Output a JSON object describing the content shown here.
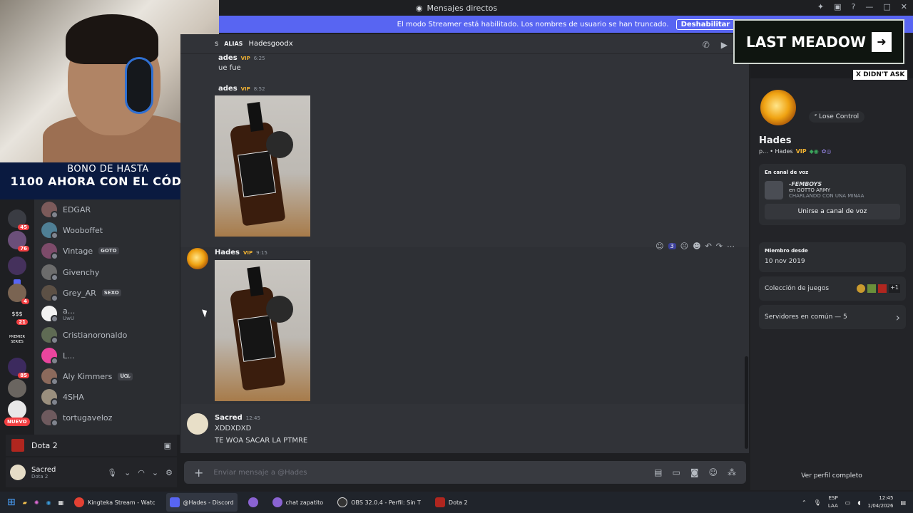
{
  "window": {
    "title": "Mensajes directos"
  },
  "streamer_banner": {
    "text": "El modo Streamer está habilitado. Los nombres de usuario se han truncado.",
    "button": "Deshabilitar"
  },
  "webcam_promo": {
    "line1": "BONO DE HASTA",
    "line2": "1100 AHORA CON EL CÓDIGO"
  },
  "overlay": {
    "title": "LAST MEADOW",
    "tag": "X DIDN'T ASK"
  },
  "guild_badges": [
    "45",
    "76",
    "4",
    "21",
    "85"
  ],
  "guild_labels": {
    "money": "$$$",
    "premier": "PREMIER SERIES",
    "new": "NUEVO"
  },
  "dm_list": [
    {
      "name": "EDGAR"
    },
    {
      "name": "Wooboffet"
    },
    {
      "name": "Vintage",
      "tag": "GOTO"
    },
    {
      "name": "Givenchy"
    },
    {
      "name": "Grey_AR",
      "tag": "SEXO"
    },
    {
      "name": "a...",
      "sub": "UwU"
    },
    {
      "name": "Cristianoronaldo"
    },
    {
      "name": "L..."
    },
    {
      "name": "Aly Kimmers",
      "tag": "ᑌᏀᏓ"
    },
    {
      "name": "4SHA"
    },
    {
      "name": "tortugaveloz"
    }
  ],
  "voice_panel": {
    "label": "Dota 2"
  },
  "user_panel": {
    "name": "Sacred",
    "game": "Dota 2"
  },
  "chat_header": {
    "partial": "s",
    "alias_label": "ALIAS",
    "alias": "Hadesgoodx"
  },
  "messages": [
    {
      "author": "ades",
      "badge": "VIP",
      "time": "6:25",
      "text": "ue fue"
    },
    {
      "author": "ades",
      "badge": "VIP",
      "time": "8:52"
    },
    {
      "author": "Hades",
      "badge": "VIP",
      "time": "9:15"
    },
    {
      "author": "Sacred",
      "time": "12:45",
      "lines": [
        "XDDXDXD",
        "TE WOA SACAR LA PTMRE"
      ]
    }
  ],
  "reaction_count": "3",
  "input": {
    "placeholder": "Enviar mensaje a @Hades"
  },
  "profile": {
    "status": "Lose Control",
    "name": "Hades",
    "tagline": "p... • Hades",
    "badge": "VIP",
    "voice_header": "En canal de voz",
    "voice_channel": "-FEMBOYS",
    "voice_server": "en GOTTO ARMY",
    "voice_status": "CHARLANDO CON UNA MINAA",
    "join_button": "Unirse a canal de voz",
    "member_since_header": "Miembro desde",
    "member_since": "10 nov 2019",
    "games_header": "Colección de juegos",
    "games_more": "+1",
    "servers": "Servidores en común — 5",
    "footer": "Ver perfil completo"
  },
  "taskbar": {
    "items": [
      "Kingteka Stream - Watc",
      "@Hades - Discord",
      "chat zapatito",
      "OBS 32.0.4 - Perfil: Sin T",
      "Dota 2"
    ],
    "lang": "ESP",
    "lang2": "LAA",
    "time": "12:45",
    "date": "1/04/2026"
  }
}
